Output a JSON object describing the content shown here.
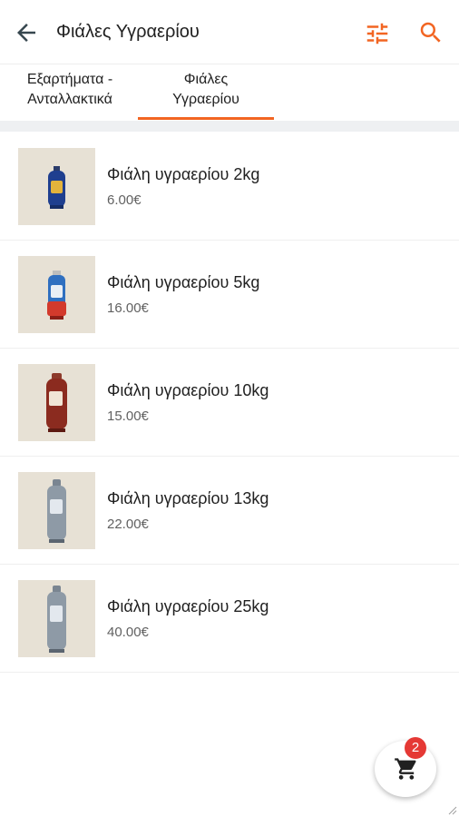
{
  "appbar": {
    "title": "Φιάλες Υγραερίου",
    "back_icon": "arrow-back-icon",
    "filter_icon": "tune-icon",
    "search_icon": "search-icon",
    "accent_color": "#f26522"
  },
  "tabs": [
    {
      "line1": "Εξαρτήματα -",
      "line2": "Ανταλλακτικά",
      "selected": false
    },
    {
      "line1": "Φιάλες",
      "line2": "Υγραερίου",
      "selected": true
    }
  ],
  "products": [
    {
      "name": "Φιάλη υγραερίου 2kg",
      "price": "6.00€",
      "image_icon": "gas-bottle-icon"
    },
    {
      "name": "Φιάλη υγραερίου 5kg",
      "price": "16.00€",
      "image_icon": "gas-bottle-icon"
    },
    {
      "name": "Φιάλη υγραερίου 10kg",
      "price": "15.00€",
      "image_icon": "gas-bottle-icon"
    },
    {
      "name": "Φιάλη υγραερίου 13kg",
      "price": "22.00€",
      "image_icon": "gas-bottle-icon"
    },
    {
      "name": "Φιάλη υγραερίου 25kg",
      "price": "40.00€",
      "image_icon": "gas-bottle-icon"
    }
  ],
  "cart": {
    "count": "2",
    "icon": "shopping-cart-icon",
    "badge_color": "#e53935"
  }
}
